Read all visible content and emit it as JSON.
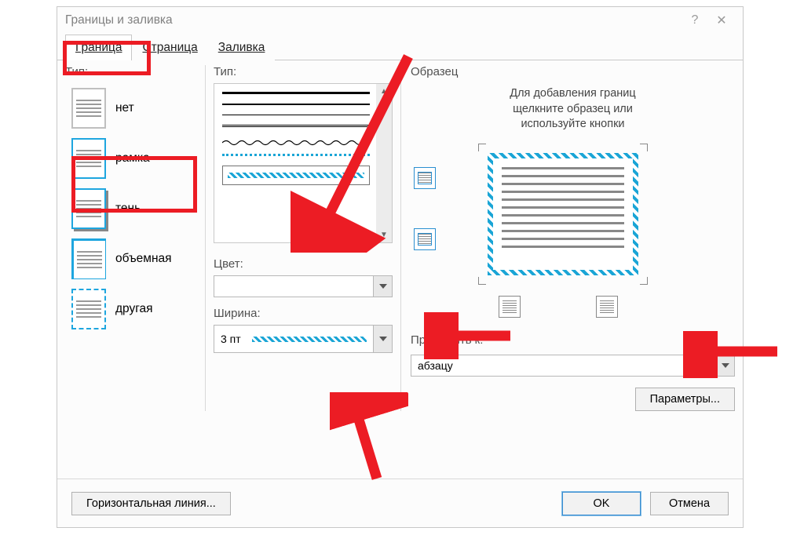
{
  "window": {
    "title": "Границы и заливка"
  },
  "tabs": {
    "border": "Граница",
    "page": "Страница",
    "fill": "Заливка"
  },
  "left": {
    "heading": "Тип:",
    "options": {
      "none": "нет",
      "box": "рамка",
      "shadow": "тень",
      "threeD": "объемная",
      "custom": "другая"
    }
  },
  "middle": {
    "style_label": "Тип:",
    "color_label": "Цвет:",
    "width_label": "Ширина:",
    "width_value": "3 пт"
  },
  "right": {
    "heading": "Образец",
    "hint_line1": "Для добавления границ",
    "hint_line2": "щелкните образец или",
    "hint_line3": "используйте кнопки",
    "apply_label": "Применить к:",
    "apply_value": "абзацу",
    "params": "Параметры..."
  },
  "footer": {
    "hline": "Горизонтальная линия...",
    "ok": "OK",
    "cancel": "Отмена"
  },
  "colors": {
    "accent": "#04a7e0",
    "teal": "#1aa5d6",
    "annotate": "#ec1c24"
  }
}
